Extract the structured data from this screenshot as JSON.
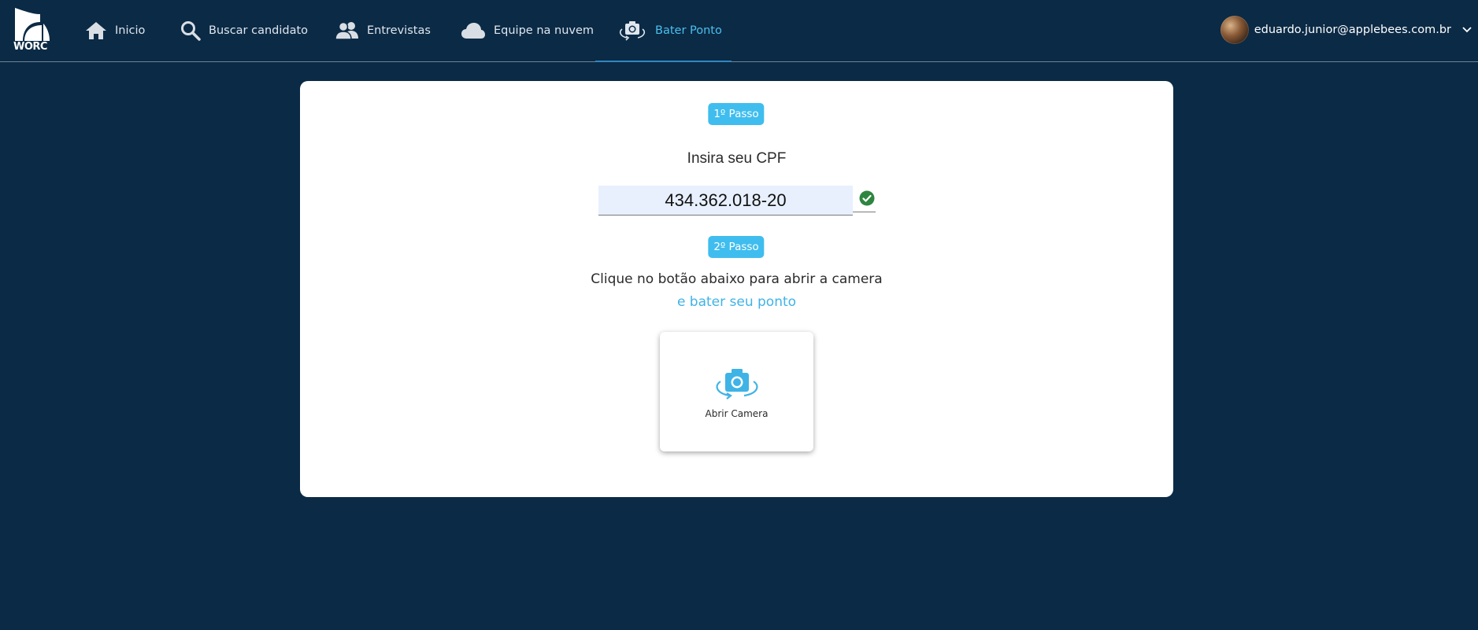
{
  "brand": {
    "logo_text": "WORC"
  },
  "nav": {
    "items": [
      {
        "label": "Inicio",
        "icon": "home-icon"
      },
      {
        "label": "Buscar candidato",
        "icon": "search-icon"
      },
      {
        "label": "Entrevistas",
        "icon": "people-icon"
      },
      {
        "label": "Equipe na nuvem",
        "icon": "cloud-icon"
      },
      {
        "label": "Bater Ponto",
        "icon": "camera-rotate-icon",
        "active": true
      }
    ]
  },
  "user": {
    "email": "eduardo.junior@applebees.com.br"
  },
  "steps": {
    "step1_label": "1º Passo",
    "cpf_label": "Insira seu CPF",
    "cpf_value": "434.362.018-20",
    "step2_label": "2º Passo",
    "instruction_line1": "Clique no botão abaixo para abrir a camera",
    "instruction_line2": "e bater seu ponto",
    "camera_button_label": "Abrir Camera"
  },
  "colors": {
    "background": "#0b2a45",
    "accent": "#3fbdee",
    "card": "#ffffff",
    "success": "#2e8540"
  }
}
